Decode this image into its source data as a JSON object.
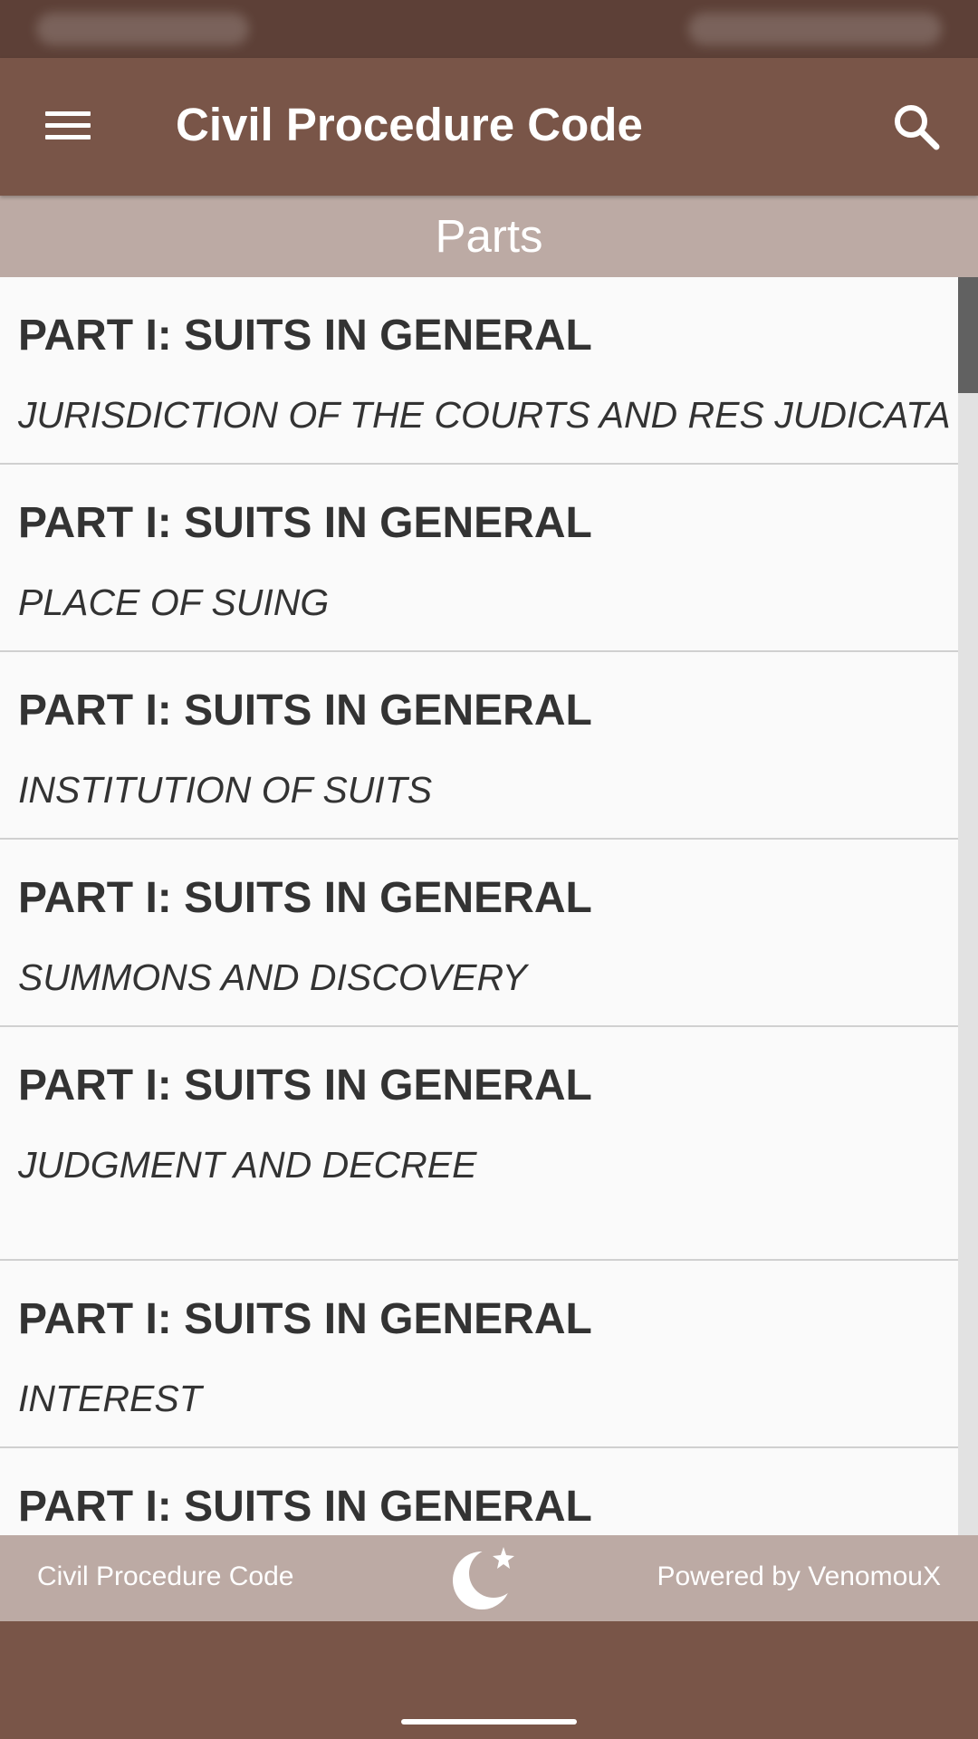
{
  "app_bar": {
    "title": "Civil Procedure Code",
    "menu_icon": "menu-icon",
    "search_icon": "search-icon"
  },
  "section_header": {
    "label": "Parts"
  },
  "list": {
    "items": [
      {
        "title": "PART I: SUITS IN GENERAL",
        "subtitle": "JURISDICTION OF THE COURTS AND RES JUDICATA"
      },
      {
        "title": "PART I: SUITS IN GENERAL",
        "subtitle": "PLACE OF SUING"
      },
      {
        "title": "PART I: SUITS IN GENERAL",
        "subtitle": "INSTITUTION OF SUITS"
      },
      {
        "title": "PART I: SUITS IN GENERAL",
        "subtitle": "SUMMONS AND DISCOVERY"
      },
      {
        "title": "PART I: SUITS IN GENERAL",
        "subtitle": "JUDGMENT AND DECREE"
      },
      {
        "title": "PART I: SUITS IN GENERAL",
        "subtitle": "INTEREST"
      },
      {
        "title": "PART I: SUITS IN GENERAL"
      }
    ]
  },
  "footer": {
    "left_text": "Civil Procedure Code",
    "right_text": "Powered by VenomouX",
    "center_icon": "crescent-star-icon"
  },
  "colors": {
    "primary": "#795548",
    "primary_dark": "#5d4037",
    "header_band": "#bcaaa4",
    "list_background": "#fafafa",
    "text": "#333333"
  }
}
